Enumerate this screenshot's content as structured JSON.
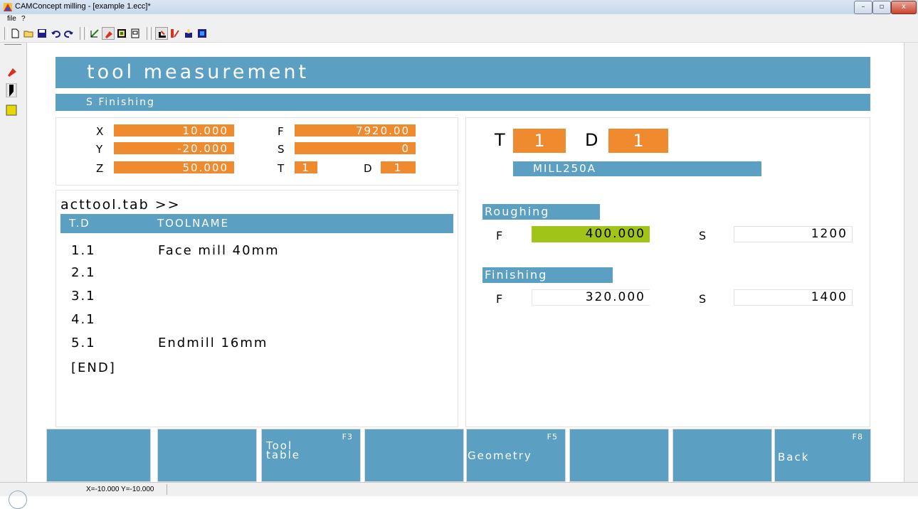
{
  "window": {
    "title": "CAMConcept milling - [example 1.ecc]*",
    "buttons": [
      "–",
      "▫",
      "x"
    ]
  },
  "menu": {
    "items": [
      "file",
      "?"
    ]
  },
  "toolbar": {
    "icons": [
      "new-file-icon",
      "open-folder-icon",
      "save-icon",
      "undo-icon",
      "redo-icon",
      "sketch-icon",
      "milling-icon",
      "simulation-icon",
      "window-icon",
      "measure-icon",
      "tool-icon",
      "machine-icon",
      "stop-icon"
    ]
  },
  "screen": {
    "title": "tool measurement",
    "subtitle": "S  Finishing",
    "axes": [
      {
        "label": "X",
        "value": "10.000"
      },
      {
        "label": "Y",
        "value": "-20.000"
      },
      {
        "label": "Z",
        "value": "50.000"
      }
    ],
    "feed": {
      "label": "F",
      "value": "7920.00"
    },
    "spindle": {
      "label": "S",
      "value": "0"
    },
    "tool": {
      "t_label": "T",
      "t_value": "1",
      "d_label": "D",
      "d_value": "1"
    },
    "big_tool": {
      "t_label": "T",
      "t_value": "1",
      "d_label": "D",
      "d_value": "1",
      "name": "MILL250A"
    },
    "tool_list": {
      "title": "acttool.tab >>",
      "col_td": "T.D",
      "col_name": "TOOLNAME",
      "rows": [
        {
          "td": "1.1",
          "name": "Face mill 40mm"
        },
        {
          "td": "2.1",
          "name": ""
        },
        {
          "td": "3.1",
          "name": ""
        },
        {
          "td": "4.1",
          "name": ""
        },
        {
          "td": "5.1",
          "name": "Endmill 16mm"
        }
      ],
      "end": "[END]"
    },
    "roughing": {
      "title": "Roughing",
      "f_label": "F",
      "f_value": "400.000",
      "s_label": "S",
      "s_value": "1200"
    },
    "finishing": {
      "title": "Finishing",
      "f_label": "F",
      "f_value": "320.000",
      "s_label": "S",
      "s_value": "1400"
    },
    "softkeys": [
      {
        "fn": "",
        "label": ""
      },
      {
        "fn": "",
        "label": ""
      },
      {
        "fn": "F3",
        "label": "Tool\ntable"
      },
      {
        "fn": "",
        "label": ""
      },
      {
        "fn": "F5",
        "label": "Geometry"
      },
      {
        "fn": "",
        "label": ""
      },
      {
        "fn": "",
        "label": ""
      },
      {
        "fn": "F8",
        "label": "Back"
      }
    ]
  },
  "status": {
    "text": "X=-10.000 Y=-10.000"
  },
  "colors": {
    "accent_blue": "#5b9fc2",
    "value_orange": "#f08a2e",
    "active_green": "#a1c418"
  }
}
